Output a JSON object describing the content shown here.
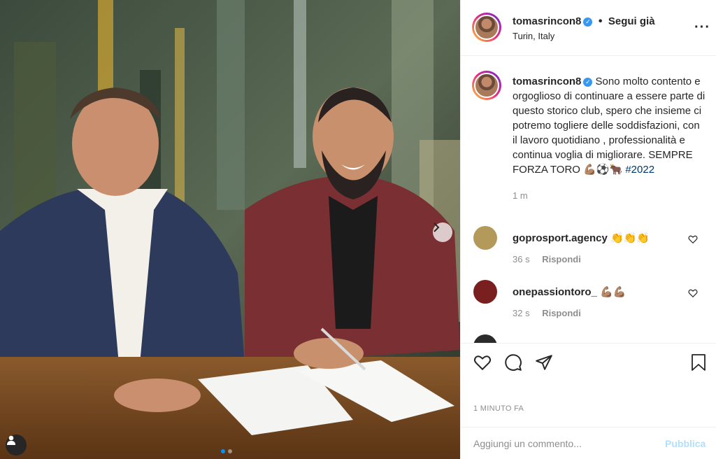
{
  "post": {
    "username": "tomasrincon8",
    "verified_mark": "✓",
    "follow_separator": "•",
    "follow_state": "Segui già",
    "location": "Turin, Italy",
    "more_icon": "···",
    "carousel": {
      "current_index": 1,
      "total": 2
    }
  },
  "caption": {
    "text": "Sono molto contento e orgoglioso di continuare a essere parte di questo storico club, spero che insieme ci potremo togliere delle soddisfazioni, con il lavoro quotidiano , professionalità e continua voglia di migliorare. SEMPRE FORZA TORO 💪🏽⚽️🐂",
    "hashtag": "#2022",
    "time": "1 m"
  },
  "comments": [
    {
      "username": "goprosport.agency",
      "text": "👏👏👏",
      "time": "36 s",
      "reply_label": "Rispondi",
      "avatar_color": "#b39a5a"
    },
    {
      "username": "onepassiontoro_",
      "text": "💪🏽💪🏽",
      "time": "32 s",
      "reply_label": "Rispondi",
      "avatar_color": "#7a1f1f"
    },
    {
      "username": "",
      "text": "",
      "time": "",
      "reply_label": "",
      "avatar_color": "#2b2b2b"
    }
  ],
  "actions": {
    "icons": [
      "heart-icon",
      "comment-icon",
      "share-icon",
      "bookmark-icon"
    ],
    "time_ago": "1 MINUTO FA"
  },
  "add_comment": {
    "placeholder": "Aggiungi un commento...",
    "publish_label": "Pubblica"
  },
  "colors": {
    "accent_blue": "#0095f6",
    "hashtag": "#00376b",
    "publish_disabled": "#b2dffc",
    "muted_text": "#8e8e8e"
  }
}
